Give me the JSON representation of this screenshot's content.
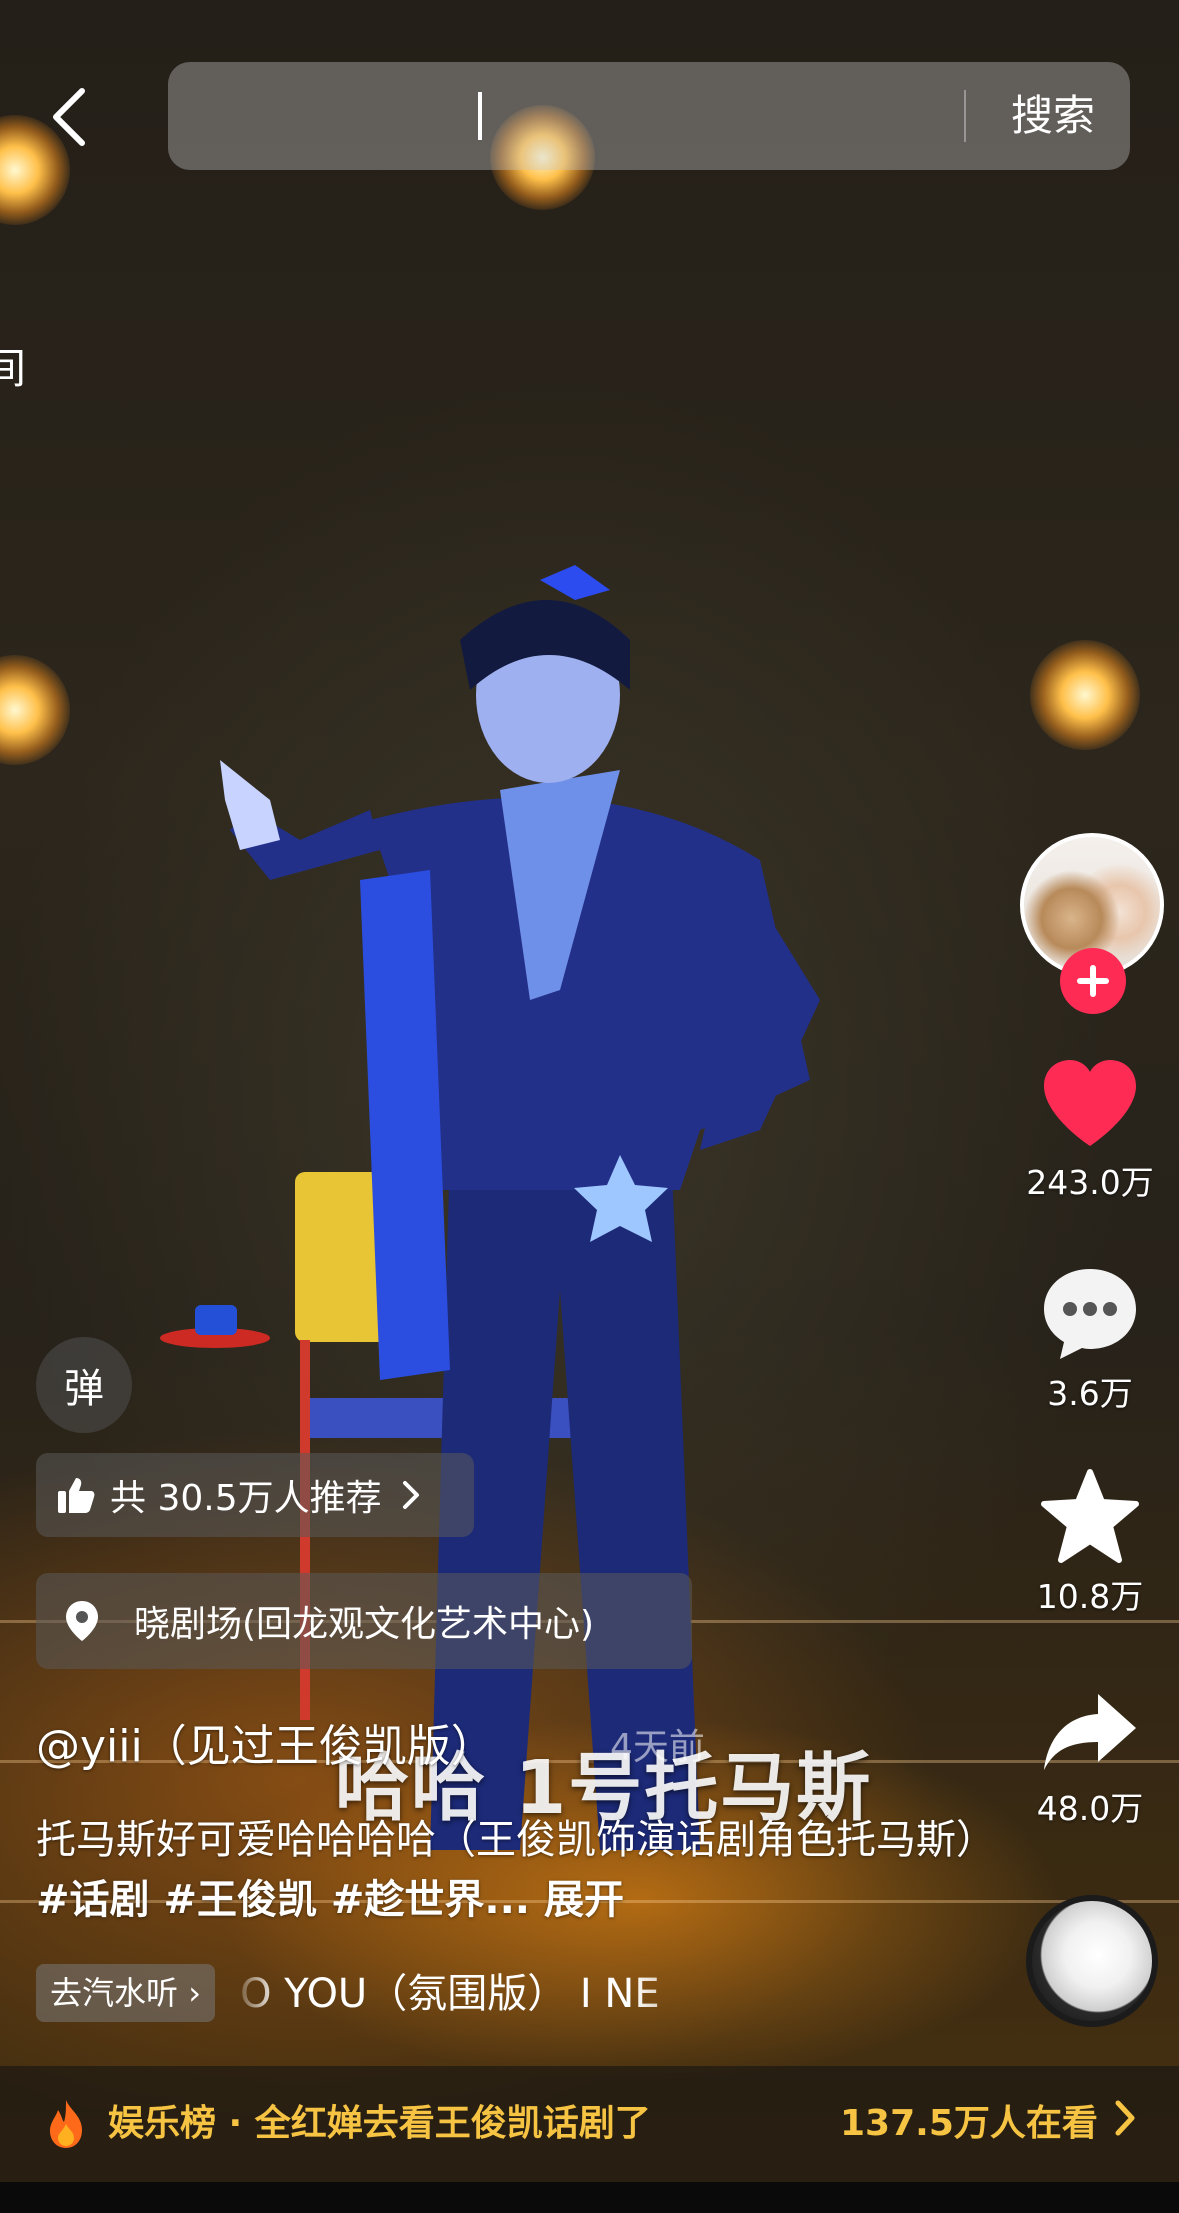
{
  "search": {
    "query_value": "",
    "button_label": "搜索"
  },
  "edge_glyph": "间",
  "author": {
    "handle": "@yiii（见过王俊凯版）",
    "post_time": "4天前"
  },
  "overlay_caption": "哈哈 1号托马斯",
  "description": {
    "text": "托马斯好可爱哈哈哈哈（王俊凯饰演话剧角色托马斯）",
    "tags": "#话剧 #王俊凯 #趁世界...",
    "expand_label": "展开"
  },
  "actions": {
    "likes": "243.0万",
    "comments": "3.6万",
    "favorites": "10.8万",
    "shares": "48.0万"
  },
  "danmaku_label": "弹",
  "recommend": {
    "text": "共 30.5万人推荐"
  },
  "location": {
    "text": "晓剧场(回龙观文化艺术中心)"
  },
  "music": {
    "tag_label": "去汽水听",
    "title": "O YOU（氛围版）  I NE"
  },
  "trending": {
    "text": "娱乐榜 · 全红婵去看王俊凯话剧了",
    "viewers": "137.5万人在看"
  },
  "colors": {
    "like_red": "#fe2c55",
    "trend_gold": "#f6c343"
  },
  "icons": [
    "back-arrow-icon",
    "heart-icon",
    "comment-icon",
    "star-icon",
    "share-icon",
    "thumbs-up-icon",
    "location-pin-icon",
    "fire-icon",
    "chevron-right-icon",
    "plus-icon"
  ]
}
